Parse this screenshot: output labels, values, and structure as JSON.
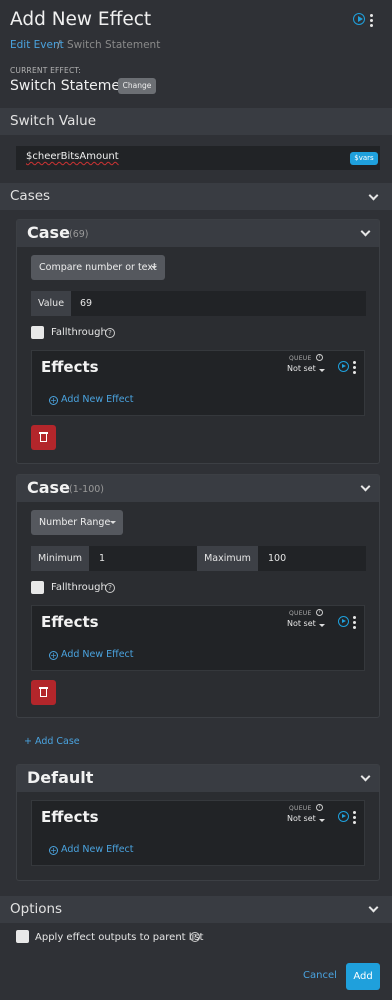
{
  "header": {
    "title": "Add New Effect",
    "breadcrumb": {
      "link": "Edit Event",
      "separator": "/",
      "current": "Switch Statement"
    },
    "current_effect_label": "CURRENT EFFECT:",
    "current_effect_name": "Switch Statement",
    "change_button": "Change"
  },
  "switch_value": {
    "section_label": "Switch Value",
    "value": "$cheerBitsAmount",
    "vars_button": "$vars"
  },
  "cases": {
    "section_label": "Cases",
    "add_case_label": "Add Case",
    "items": [
      {
        "title": "Case",
        "subtitle": "(69)",
        "compare_label": "Compare number or text",
        "value_label": "Value",
        "value": "69",
        "fallthrough_label": "Fallthrough",
        "effects": {
          "title": "Effects",
          "queue_label": "QUEUE",
          "queue_value": "Not set",
          "add_label": "Add New Effect"
        }
      },
      {
        "title": "Case",
        "subtitle": "(1-100)",
        "compare_label": "Number Range",
        "min_label": "Minimum",
        "min_value": "1",
        "max_label": "Maximum",
        "max_value": "100",
        "fallthrough_label": "Fallthrough",
        "effects": {
          "title": "Effects",
          "queue_label": "QUEUE",
          "queue_value": "Not set",
          "add_label": "Add New Effect"
        }
      }
    ]
  },
  "default_case": {
    "title": "Default",
    "effects": {
      "title": "Effects",
      "queue_label": "QUEUE",
      "queue_value": "Not set",
      "add_label": "Add New Effect"
    }
  },
  "options": {
    "section_label": "Options",
    "apply_outputs_label": "Apply effect outputs to parent list"
  },
  "footer": {
    "cancel_label": "Cancel",
    "add_label": "Add"
  },
  "colors": {
    "accent": "#1fa0dc",
    "link": "#4aa3df",
    "danger": "#b3262b",
    "background": "#2f3136"
  },
  "icons": [
    "play-icon",
    "kebab-menu-icon",
    "chevron-down-icon",
    "caret-down-icon",
    "help-icon",
    "plus-circle-icon",
    "trash-icon",
    "plus-icon"
  ]
}
